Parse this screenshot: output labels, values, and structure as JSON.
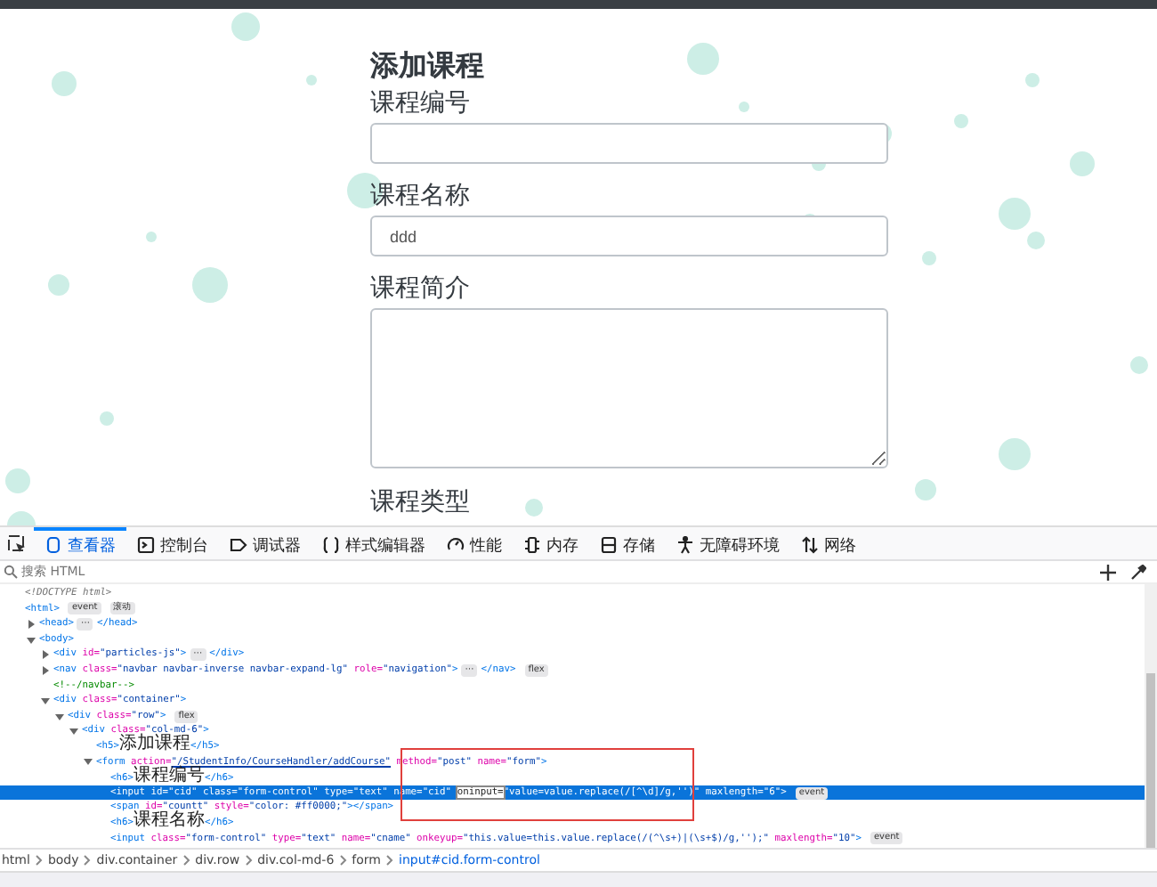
{
  "page": {
    "heading": "添加课程",
    "fields": [
      {
        "kind": "input",
        "label": "课程编号"
      },
      {
        "kind": "input",
        "label": "课程名称",
        "value": "ddd"
      },
      {
        "kind": "textarea",
        "label": "课程简介"
      },
      {
        "kind": "label",
        "label": "课程类型"
      }
    ]
  },
  "devtools": {
    "tabs": [
      {
        "label": "查看器",
        "selected": true
      },
      {
        "label": "控制台",
        "selected": false
      },
      {
        "label": "调试器",
        "selected": false
      },
      {
        "label": "样式编辑器",
        "selected": false
      },
      {
        "label": "性能",
        "selected": false
      },
      {
        "label": "内存",
        "selected": false
      },
      {
        "label": "存储",
        "selected": false
      },
      {
        "label": "无障碍环境",
        "selected": false
      },
      {
        "label": "网络",
        "selected": false
      }
    ],
    "search": {
      "placeholder": "搜索 HTML"
    },
    "tree": [
      {
        "selected": false,
        "segments": [
          {
            "kind": "code",
            "tokens": [
              {
                "kind": "doctype",
                "text": "<!DOCTYPE html>"
              }
            ]
          }
        ]
      },
      {
        "selected": false,
        "segments": [
          {
            "kind": "code",
            "tokens": [
              {
                "kind": "tag",
                "text": "<html>"
              }
            ]
          },
          {
            "kind": "badge",
            "text": "event"
          },
          {
            "kind": "badge",
            "text": "滚动"
          }
        ],
        "children": [
          {
            "selected": false,
            "expanded": false,
            "segments": [
              {
                "kind": "code",
                "tokens": [
                  {
                    "kind": "tag",
                    "text": "<head>"
                  }
                ]
              },
              {
                "kind": "more",
                "text": "⋯"
              },
              {
                "kind": "code",
                "tokens": [
                  {
                    "kind": "tag",
                    "text": "</head>"
                  }
                ]
              }
            ]
          },
          {
            "selected": false,
            "expanded": true,
            "segments": [
              {
                "kind": "code",
                "tokens": [
                  {
                    "kind": "tag",
                    "text": "<body>"
                  }
                ]
              }
            ],
            "children": [
              {
                "selected": false,
                "expanded": false,
                "segments": [
                  {
                    "kind": "code",
                    "tokens": [
                      {
                        "kind": "tag",
                        "text": "<div"
                      },
                      {
                        "kind": "attr",
                        "text": " id="
                      },
                      {
                        "kind": "value",
                        "text": "\"particles-js\""
                      },
                      {
                        "kind": "tag",
                        "text": ">"
                      }
                    ]
                  },
                  {
                    "kind": "more",
                    "text": "⋯"
                  },
                  {
                    "kind": "code",
                    "tokens": [
                      {
                        "kind": "tag",
                        "text": "</div>"
                      }
                    ]
                  }
                ]
              },
              {
                "selected": false,
                "expanded": false,
                "segments": [
                  {
                    "kind": "code",
                    "tokens": [
                      {
                        "kind": "tag",
                        "text": "<nav"
                      },
                      {
                        "kind": "attr",
                        "text": " class="
                      },
                      {
                        "kind": "value",
                        "text": "\"navbar navbar-inverse navbar-expand-lg\""
                      },
                      {
                        "kind": "attr",
                        "text": " role="
                      },
                      {
                        "kind": "value",
                        "text": "\"navigation\""
                      },
                      {
                        "kind": "tag",
                        "text": ">"
                      }
                    ]
                  },
                  {
                    "kind": "more",
                    "text": "⋯"
                  },
                  {
                    "kind": "code",
                    "tokens": [
                      {
                        "kind": "tag",
                        "text": "</nav>"
                      }
                    ]
                  },
                  {
                    "kind": "badge",
                    "text": "flex"
                  }
                ]
              },
              {
                "selected": false,
                "segments": [
                  {
                    "kind": "code",
                    "tokens": [
                      {
                        "kind": "comment",
                        "text": "<!--/navbar-->"
                      }
                    ]
                  }
                ]
              },
              {
                "selected": false,
                "expanded": true,
                "segments": [
                  {
                    "kind": "code",
                    "tokens": [
                      {
                        "kind": "tag",
                        "text": "<div"
                      },
                      {
                        "kind": "attr",
                        "text": " class="
                      },
                      {
                        "kind": "value",
                        "text": "\"container\""
                      },
                      {
                        "kind": "tag",
                        "text": ">"
                      }
                    ]
                  }
                ],
                "children": [
                  {
                    "selected": false,
                    "expanded": true,
                    "segments": [
                      {
                        "kind": "code",
                        "tokens": [
                          {
                            "kind": "tag",
                            "text": "<div"
                          },
                          {
                            "kind": "attr",
                            "text": " class="
                          },
                          {
                            "kind": "value",
                            "text": "\"row\""
                          },
                          {
                            "kind": "tag",
                            "text": ">"
                          }
                        ]
                      },
                      {
                        "kind": "badge",
                        "text": "flex"
                      }
                    ],
                    "children": [
                      {
                        "selected": false,
                        "expanded": true,
                        "segments": [
                          {
                            "kind": "code",
                            "tokens": [
                              {
                                "kind": "tag",
                                "text": "<div"
                              },
                              {
                                "kind": "attr",
                                "text": " class="
                              },
                              {
                                "kind": "value",
                                "text": "\"col-md-6\""
                              },
                              {
                                "kind": "tag",
                                "text": ">"
                              }
                            ]
                          }
                        ],
                        "children": [
                          {
                            "selected": false,
                            "segments": [
                              {
                                "kind": "code",
                                "tokens": [
                                  {
                                    "kind": "tag",
                                    "text": "<h5>"
                                  },
                                  {
                                    "kind": "text",
                                    "text": "添加课程"
                                  },
                                  {
                                    "kind": "tag",
                                    "text": "</h5>"
                                  }
                                ]
                              }
                            ]
                          },
                          {
                            "selected": false,
                            "expanded": true,
                            "segments": [
                              {
                                "kind": "code",
                                "tokens": [
                                  {
                                    "kind": "tag",
                                    "text": "<form"
                                  },
                                  {
                                    "kind": "attr",
                                    "text": " action="
                                  },
                                  {
                                    "kind": "link",
                                    "text": "\"/StudentInfo/CourseHandler/addCourse\""
                                  },
                                  {
                                    "kind": "attr",
                                    "text": " method="
                                  },
                                  {
                                    "kind": "value",
                                    "text": "\"post\""
                                  },
                                  {
                                    "kind": "attr",
                                    "text": " name="
                                  },
                                  {
                                    "kind": "value",
                                    "text": "\"form\""
                                  },
                                  {
                                    "kind": "tag",
                                    "text": ">"
                                  }
                                ]
                              }
                            ],
                            "children": [
                              {
                                "selected": false,
                                "segments": [
                                  {
                                    "kind": "code",
                                    "tokens": [
                                      {
                                        "kind": "tag",
                                        "text": "<h6>"
                                      },
                                      {
                                        "kind": "text",
                                        "text": "课程编号"
                                      },
                                      {
                                        "kind": "tag",
                                        "text": "</h6>"
                                      }
                                    ]
                                  }
                                ]
                              },
                              {
                                "selected": true,
                                "segments": [
                                  {
                                    "kind": "code",
                                    "tokens": [
                                      {
                                        "kind": "tag",
                                        "text": "<input"
                                      },
                                      {
                                        "kind": "attr",
                                        "text": " id="
                                      },
                                      {
                                        "kind": "value",
                                        "text": "\"cid\""
                                      },
                                      {
                                        "kind": "attr",
                                        "text": " class="
                                      },
                                      {
                                        "kind": "value",
                                        "text": "\"form-control\""
                                      },
                                      {
                                        "kind": "attr",
                                        "text": " type="
                                      },
                                      {
                                        "kind": "value",
                                        "text": "\"text\""
                                      },
                                      {
                                        "kind": "attr",
                                        "text": " name="
                                      },
                                      {
                                        "kind": "value",
                                        "text": "\"cid\""
                                      },
                                      {
                                        "kind": "focus",
                                        "text": "oninput="
                                      },
                                      {
                                        "kind": "value",
                                        "text": "\"value=value.replace(/[^\\d]/g,'')\""
                                      },
                                      {
                                        "kind": "attr",
                                        "text": " maxlength="
                                      },
                                      {
                                        "kind": "value",
                                        "text": "\"6\""
                                      },
                                      {
                                        "kind": "tag",
                                        "text": ">"
                                      }
                                    ]
                                  },
                                  {
                                    "kind": "badge",
                                    "text": "event"
                                  }
                                ]
                              },
                              {
                                "selected": false,
                                "segments": [
                                  {
                                    "kind": "code",
                                    "tokens": [
                                      {
                                        "kind": "tag",
                                        "text": "<span"
                                      },
                                      {
                                        "kind": "attr",
                                        "text": " id="
                                      },
                                      {
                                        "kind": "value",
                                        "text": "\"countt\""
                                      },
                                      {
                                        "kind": "attr",
                                        "text": " style="
                                      },
                                      {
                                        "kind": "value",
                                        "text": "\"color: #ff0000;\""
                                      },
                                      {
                                        "kind": "tag",
                                        "text": "></span>"
                                      }
                                    ]
                                  }
                                ]
                              },
                              {
                                "selected": false,
                                "segments": [
                                  {
                                    "kind": "code",
                                    "tokens": [
                                      {
                                        "kind": "tag",
                                        "text": "<h6>"
                                      },
                                      {
                                        "kind": "text",
                                        "text": "课程名称"
                                      },
                                      {
                                        "kind": "tag",
                                        "text": "</h6>"
                                      }
                                    ]
                                  }
                                ]
                              },
                              {
                                "selected": false,
                                "segments": [
                                  {
                                    "kind": "code",
                                    "tokens": [
                                      {
                                        "kind": "tag",
                                        "text": "<input"
                                      },
                                      {
                                        "kind": "attr",
                                        "text": " class="
                                      },
                                      {
                                        "kind": "value",
                                        "text": "\"form-control\""
                                      },
                                      {
                                        "kind": "attr",
                                        "text": " type="
                                      },
                                      {
                                        "kind": "value",
                                        "text": "\"text\""
                                      },
                                      {
                                        "kind": "attr",
                                        "text": " name="
                                      },
                                      {
                                        "kind": "value",
                                        "text": "\"cname\""
                                      },
                                      {
                                        "kind": "attr",
                                        "text": " onkeyup="
                                      },
                                      {
                                        "kind": "value",
                                        "text": "\"this.value=this.value.replace(/(^\\s+)|(\\s+$)/g,'');\""
                                      },
                                      {
                                        "kind": "attr",
                                        "text": " maxlength="
                                      },
                                      {
                                        "kind": "value",
                                        "text": "\"10\""
                                      },
                                      {
                                        "kind": "tag",
                                        "text": ">"
                                      }
                                    ]
                                  },
                                  {
                                    "kind": "badge",
                                    "text": "event"
                                  }
                                ]
                              }
                            ]
                          }
                        ]
                      }
                    ]
                  }
                ]
              }
            ]
          }
        ]
      }
    ],
    "breadcrumbs": [
      "html",
      "body",
      "div.container",
      "div.row",
      "div.col-md-6",
      "form",
      "input#cid.form-control"
    ]
  }
}
